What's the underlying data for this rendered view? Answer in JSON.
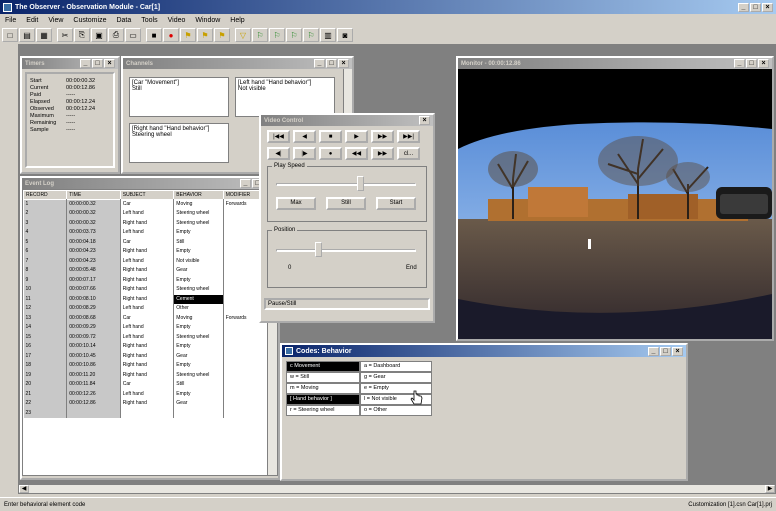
{
  "app": {
    "title": "The Observer - Observation Module - Car[1]",
    "menu": [
      "File",
      "Edit",
      "View",
      "Customize",
      "Data",
      "Tools",
      "Video",
      "Window",
      "Help"
    ]
  },
  "toolbar": {
    "icons": [
      "new-icon",
      "open-icon",
      "save-icon",
      "cut-icon",
      "copy-icon",
      "paste-icon",
      "print-icon",
      "preview-icon",
      "stop-icon",
      "record-icon",
      "event-icon",
      "sample-icon",
      "marker-icon",
      "filter-icon",
      "flag-icon",
      "flag2-icon",
      "flag3-icon",
      "flag4-icon",
      "chart-icon",
      "camera-icon"
    ]
  },
  "timers": {
    "title": "Timers",
    "rows": [
      {
        "label": "Start",
        "value": "00:00:00.32"
      },
      {
        "label": "Current",
        "value": "00:00:12.86"
      },
      {
        "label": "Paid",
        "value": "-----"
      },
      {
        "label": "Elapsed",
        "value": "00:00:12.24"
      },
      {
        "label": "Observed",
        "value": "00:00:12.24"
      },
      {
        "label": "Maximum",
        "value": "-----"
      },
      {
        "label": "Remaining",
        "value": "-----"
      },
      {
        "label": "Sample",
        "value": "-----"
      }
    ]
  },
  "channels": {
    "title": "Channels",
    "boxes": [
      {
        "header": "[Car \"Movement\"]",
        "value": "Still"
      },
      {
        "header": "[Left hand \"Hand behavior\"]",
        "value": "Not visible"
      },
      {
        "header": "[Right hand \"Hand behavior\"]",
        "value": "Steering wheel"
      }
    ]
  },
  "event_log": {
    "title": "Event Log",
    "columns": [
      "RECORD",
      "TIME",
      "SUBJECT",
      "BEHAVIOR",
      "MODIFIER"
    ],
    "rows": [
      [
        "1",
        "00:00:00.32",
        "Car",
        "Moving",
        "Forwards"
      ],
      [
        "2",
        "00:00:00.32",
        "Left hand",
        "Steering wheel",
        ""
      ],
      [
        "3",
        "00:00:00.32",
        "Right hand",
        "Steering wheel",
        ""
      ],
      [
        "4",
        "00:00:03.73",
        "Left hand",
        "Empty",
        ""
      ],
      [
        "5",
        "00:00:04.18",
        "Car",
        "Still",
        ""
      ],
      [
        "6",
        "00:00:04.23",
        "Right hand",
        "Empty",
        ""
      ],
      [
        "7",
        "00:00:04.23",
        "Left hand",
        "Not visible",
        ""
      ],
      [
        "8",
        "00:00:05.48",
        "Right hand",
        "Gear",
        ""
      ],
      [
        "9",
        "00:00:07.17",
        "Right hand",
        "Empty",
        ""
      ],
      [
        "10",
        "00:00:07.66",
        "Right hand",
        "Steering wheel",
        ""
      ],
      [
        "11",
        "00:00:08.10",
        "Right hand",
        "Cement",
        ""
      ],
      [
        "12",
        "00:00:08.29",
        "Left hand",
        "Other",
        ""
      ],
      [
        "13",
        "00:00:08.68",
        "Car",
        "Moving",
        "Forwards"
      ],
      [
        "14",
        "00:00:09.29",
        "Left hand",
        "Empty",
        ""
      ],
      [
        "15",
        "00:00:09.72",
        "Left hand",
        "Steering wheel",
        ""
      ],
      [
        "16",
        "00:00:10.14",
        "Right hand",
        "Empty",
        ""
      ],
      [
        "17",
        "00:00:10.45",
        "Right hand",
        "Gear",
        ""
      ],
      [
        "18",
        "00:00:10.86",
        "Right hand",
        "Empty",
        ""
      ],
      [
        "19",
        "00:00:11.20",
        "Right hand",
        "Steering wheel",
        ""
      ],
      [
        "20",
        "00:00:11.84",
        "Car",
        "Still",
        ""
      ],
      [
        "21",
        "00:00:12.26",
        "Left hand",
        "Empty",
        ""
      ],
      [
        "22",
        "00:00:12.86",
        "Right hand",
        "Gear",
        ""
      ],
      [
        "23",
        "",
        "",
        "",
        ""
      ]
    ],
    "selected_row": 10
  },
  "video_control": {
    "title": "Video Control",
    "row1": [
      "|◀◀",
      "◀",
      "■",
      "▶",
      "▶▶",
      "▶▶|"
    ],
    "row2": [
      "◀|",
      "|▶",
      "●",
      "◀◀",
      "▶▶",
      "cl..."
    ],
    "play_speed_label": "Play Speed",
    "speed_buttons": [
      "Max",
      "Still",
      "Start"
    ],
    "position_label": "Position",
    "position_start": "0",
    "position_end": "End",
    "status": "Pause/Still",
    "speed_fraction": 0.6,
    "position_fraction": 0.3
  },
  "monitor": {
    "title": "Monitor - 00:00:12.86"
  },
  "codes": {
    "title": "Codes: Behavior",
    "left": [
      {
        "text": "c Movement",
        "header": true
      },
      {
        "text": "w = Still",
        "header": false
      },
      {
        "text": "m = Moving",
        "header": false
      },
      {
        "text": "[ Hand behavior ]",
        "header": true
      },
      {
        "text": "r = Steering wheel",
        "header": false
      }
    ],
    "right": [
      {
        "text": "a = Dashboard"
      },
      {
        "text": "g = Gear"
      },
      {
        "text": "e = Empty"
      },
      {
        "text": "l = Not visible"
      },
      {
        "text": "o = Other"
      }
    ]
  },
  "statusbar": {
    "left": "Enter behavioral element code",
    "right": "Customization [1].csn   Car[1].prj"
  },
  "colors": {
    "title_active": "#0a246a",
    "title_gradient_end": "#a6caf0",
    "desktop": "#808080",
    "selected": "#000000"
  }
}
